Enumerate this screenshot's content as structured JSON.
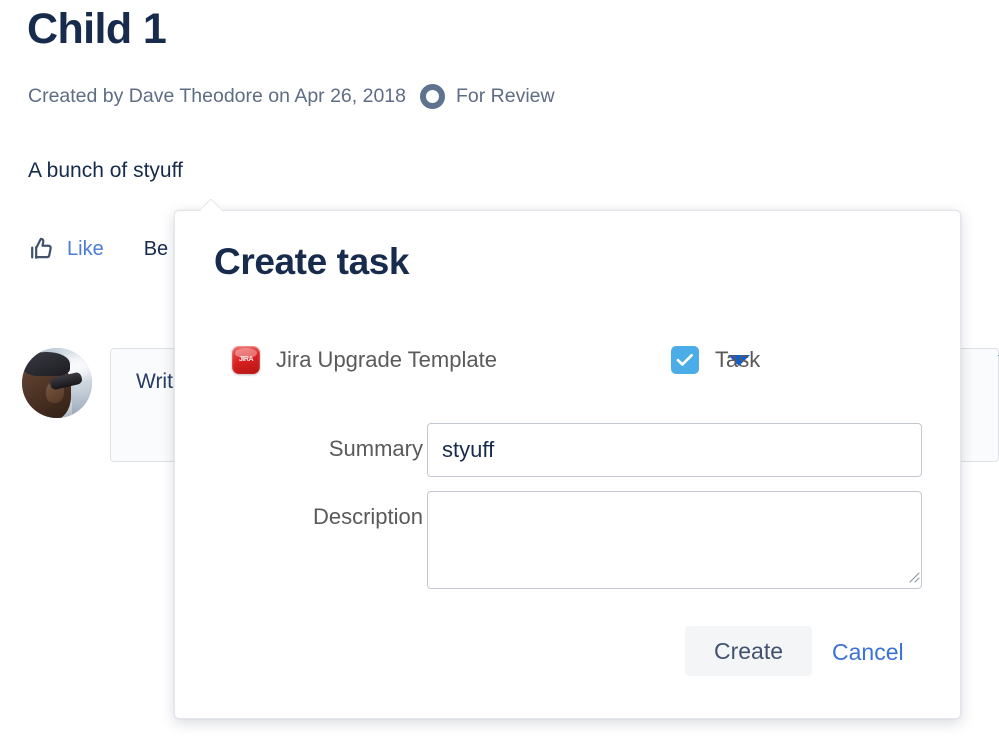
{
  "page": {
    "title": "Child 1",
    "byline": "Created by Dave Theodore on Apr 26, 2018",
    "status": {
      "label": "For Review",
      "icon": "status-ring-icon",
      "color": "#5d738e"
    },
    "body_text": "A bunch of styuff",
    "actions": {
      "like_label": "Like",
      "like_icon": "thumbs-up-icon",
      "secondary_label": "Be"
    },
    "comment": {
      "placeholder": "Writ",
      "avatar_alt": "user-avatar"
    }
  },
  "dialog": {
    "title": "Create task",
    "project": {
      "label": "Jira Upgrade Template",
      "icon": "jira-project-icon",
      "caret_icon": "chevron-down-icon",
      "caret_color": "#0b5fd6"
    },
    "issue_type": {
      "label": "Task",
      "icon": "task-checkbox-icon",
      "icon_color": "#4bade8",
      "caret_icon": "chevron-down-icon",
      "caret_color": "#172b4d"
    },
    "fields": {
      "summary": {
        "label": "Summary",
        "required_marker": "*",
        "required_color": "#d04437",
        "value": "styuff",
        "placeholder": ""
      },
      "description": {
        "label": "Description",
        "value": "",
        "placeholder": "",
        "resize_icon": "resize-grip-icon"
      }
    },
    "footer": {
      "create_label": "Create",
      "cancel_label": "Cancel",
      "cancel_color": "#3b73d4"
    }
  }
}
